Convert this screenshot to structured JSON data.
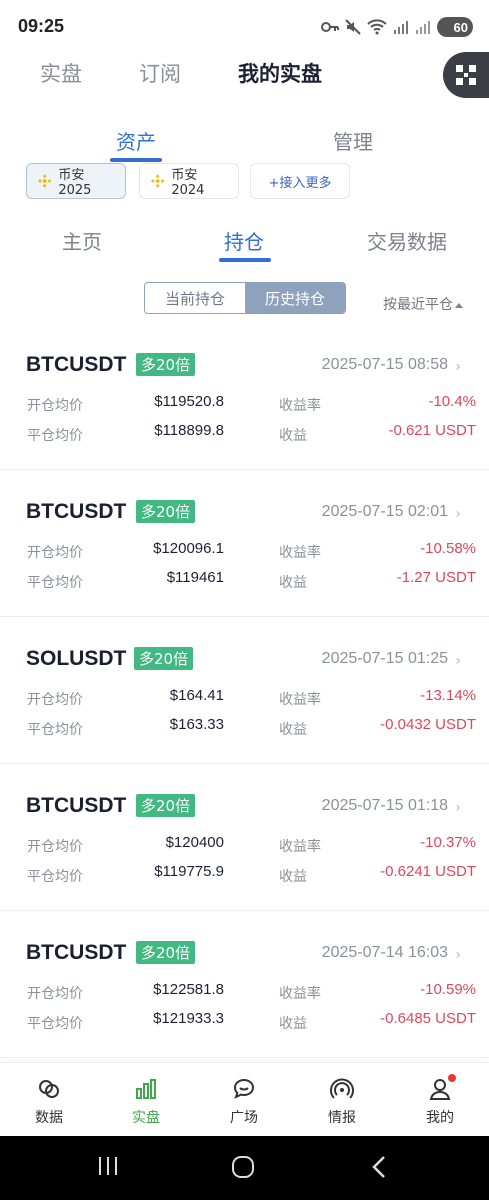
{
  "status_bar": {
    "time": "09:25",
    "battery": "60"
  },
  "top_nav": {
    "tabs": [
      {
        "label": "实盘",
        "active": false
      },
      {
        "label": "订阅",
        "active": false
      },
      {
        "label": "我的实盘",
        "active": true
      }
    ],
    "qr_icon": "qr-scan-icon"
  },
  "sub_tabs": {
    "tabs": [
      {
        "label": "资产",
        "active": true
      },
      {
        "label": "管理",
        "active": false
      }
    ]
  },
  "accounts": [
    {
      "label": "币安2025",
      "active": true,
      "icon": "binance-icon"
    },
    {
      "label": "币安2024",
      "active": false,
      "icon": "binance-icon"
    },
    {
      "label": "+接入更多",
      "active": false
    }
  ],
  "section_tabs": {
    "tabs": [
      {
        "label": "主页",
        "active": false
      },
      {
        "label": "持仓",
        "active": true
      },
      {
        "label": "交易数据",
        "active": false
      }
    ]
  },
  "position_toggle": {
    "current": "当前持仓",
    "history": "历史持仓",
    "selected": "history"
  },
  "sort": {
    "label": "按最近平仓"
  },
  "field_labels": {
    "open_avg": "开仓均价",
    "close_avg": "平仓均价",
    "return_rate": "收益率",
    "profit": "收益"
  },
  "positions": [
    {
      "symbol": "BTCUSDT",
      "leverage": "多20倍",
      "time": "2025-07-15 08:58",
      "open_avg": "$119520.8",
      "close_avg": "$118899.8",
      "return_rate": "-10.4%",
      "profit": "-0.621 USDT"
    },
    {
      "symbol": "BTCUSDT",
      "leverage": "多20倍",
      "time": "2025-07-15 02:01",
      "open_avg": "$120096.1",
      "close_avg": "$119461",
      "return_rate": "-10.58%",
      "profit": "-1.27 USDT"
    },
    {
      "symbol": "SOLUSDT",
      "leverage": "多20倍",
      "time": "2025-07-15 01:25",
      "open_avg": "$164.41",
      "close_avg": "$163.33",
      "return_rate": "-13.14%",
      "profit": "-0.0432 USDT"
    },
    {
      "symbol": "BTCUSDT",
      "leverage": "多20倍",
      "time": "2025-07-15 01:18",
      "open_avg": "$120400",
      "close_avg": "$119775.9",
      "return_rate": "-10.37%",
      "profit": "-0.6241 USDT"
    },
    {
      "symbol": "BTCUSDT",
      "leverage": "多20倍",
      "time": "2025-07-14 16:03",
      "open_avg": "$122581.8",
      "close_avg": "$121933.3",
      "return_rate": "-10.59%",
      "profit": "-0.6485 USDT"
    }
  ],
  "bottom_nav": [
    {
      "label": "数据",
      "icon": "data-icon",
      "active": false
    },
    {
      "label": "实盘",
      "icon": "bar-chart-icon",
      "active": true
    },
    {
      "label": "广场",
      "icon": "chat-bubble-icon",
      "active": false
    },
    {
      "label": "情报",
      "icon": "signal-icon",
      "active": false
    },
    {
      "label": "我的",
      "icon": "user-icon",
      "active": false,
      "badge": true
    }
  ],
  "colors": {
    "accent_blue": "#2f6fd6",
    "leverage_green": "#42b883",
    "loss_red": "#e0465b",
    "nav_active_green": "#3fa84b"
  }
}
